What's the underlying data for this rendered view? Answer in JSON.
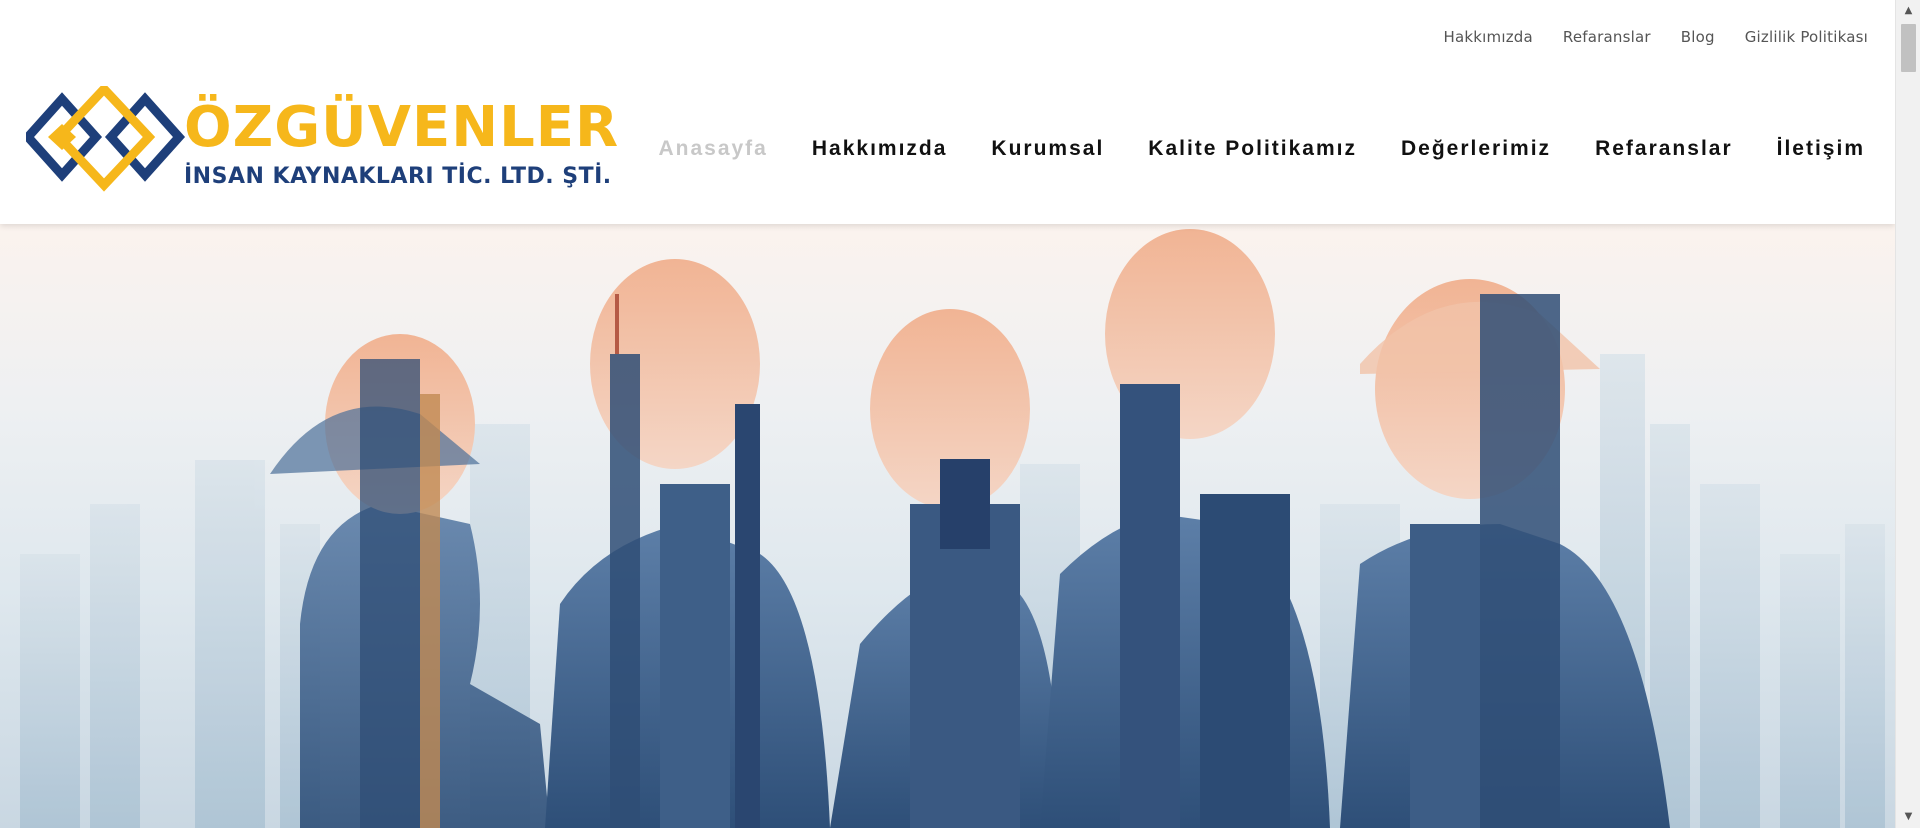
{
  "topbar": {
    "links": [
      "Hakkımızda",
      "Refaranslar",
      "Blog",
      "Gizlilik Politikası"
    ]
  },
  "logo": {
    "brand": "ÖZGÜVENLER",
    "subtitle": "İNSAN KAYNAKLARI TİC. LTD. ŞTİ.",
    "colors": {
      "gold": "#f6b71b",
      "navy": "#1e3f7a"
    }
  },
  "nav": {
    "items": [
      "Anasayfa",
      "Hakkımızda",
      "Kurumsal",
      "Kalite Politikamız",
      "Değerlerimiz",
      "Refaranslar",
      "İletişim"
    ],
    "active": "Anasayfa"
  },
  "hero": {
    "image": "double-exposure-workers-city-skyline"
  },
  "scrollbar": {
    "up_icon": "arrow-up-icon",
    "down_icon": "arrow-down-icon"
  }
}
